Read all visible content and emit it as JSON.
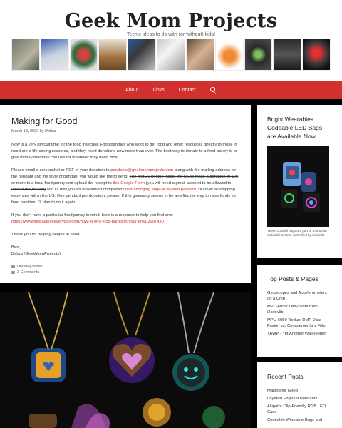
{
  "site": {
    "title": "Geek Mom Projects",
    "tagline": "Techie ideas to do with (or without) kids!"
  },
  "nav": {
    "items": [
      "About",
      "Links",
      "Contact"
    ]
  },
  "article": {
    "title": "Making for Good",
    "date": "March 18, 2020",
    "by": "by",
    "author": "Debra",
    "p1": "Now is a very difficult time for the food insecure. Food pantries who work to get food and other resources directly to those in need are a life-saving resource, and they need donations now more than ever. The best way to donate to a food pantry is to give money that they can use for whatever they need most.",
    "p2_a": "Please email a screenshot or PDF of your donation to ",
    "p2_email": "pendants@geekmomprojects.com",
    "p2_b": " along with the mailing address for the pendant and the style of pendant you would like me to send. ",
    "p2_strike1": "The first 20 people inside the US to make a donation of $20 or more to a local food pantry and upload the receipt to ",
    "p2_form": "this Google Form",
    "p2_strike2": " (you will need a gmail account to be allowed to upload the receipt)",
    "p2_c": " and I'll mail you an assembled completed ",
    "p2_link": "color-changing edge-lit layered pendant",
    "p2_d": ". I'll cover all shipping expenses within the US. One pendant per donation, please. If this giveaway seems to be an effective way to raise funds for food pantries, I'll plan to do it again.",
    "p3": "If you don't have a particular food pantry in mind, here is a resource to help you find one:",
    "p3_link": "https://www.thebalanceeveryday.com/how-to-find-food-banks-in-your-area-2997430",
    "p4": "Thank you for helping people in need.",
    "p5_line1": "Best,",
    "p5_line2": "Debra (GeekMomProjects)",
    "category": "Uncategorized",
    "comments": "3 Comments"
  },
  "sidebar": {
    "widget1": {
      "title": "Bright Wearables Codeable LED Bags are Available Now",
      "caption": "These colorful bags are part of a modular codeable system controlled by micro:bit"
    },
    "widget2": {
      "title": "Top Posts & Pages",
      "items": [
        "Gyroscopes and Accelerometers on a Chip",
        "MPU-6050: DMP Data from i2cdevlib",
        "MPU-6050 Redux: DMP Data Fusion vs. Complementary Filter",
        "YAWP - Yet Another Wall Plotter"
      ]
    },
    "widget3": {
      "title": "Recent Posts",
      "items": [
        "Making for Good",
        "Layered Edge-Lit Pendants",
        "Alligator Clip-Friendly RGB LED Case",
        "Codeable Wearable Bags and"
      ]
    }
  },
  "colors": {
    "accent": "#d22f2f",
    "background": "#000000"
  }
}
